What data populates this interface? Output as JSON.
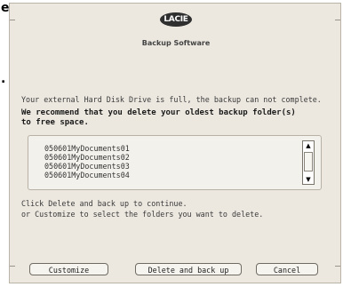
{
  "background_text": {
    "top_char": "e",
    "dot_char": "."
  },
  "dialog": {
    "logo": "LACIE",
    "subtitle": "Backup Software",
    "message": "Your external Hard Disk Drive is full, the backup can not complete.",
    "recommendation_line1": "We recommend that you delete your oldest backup folder(s)",
    "recommendation_line2": "to free space.",
    "folders": [
      "050601MyDocuments01",
      "050601MyDocuments02",
      "050601MyDocuments03",
      "050601MyDocuments04"
    ],
    "instruction_line1": "Click Delete and back up to continue.",
    "instruction_line2": "or Customize to select the folders you want to delete.",
    "buttons": {
      "customize": "Customize",
      "delete_backup": "Delete and back up",
      "cancel": "Cancel"
    }
  },
  "scrollbar": {
    "up_glyph": "▲",
    "down_glyph": "▼"
  }
}
